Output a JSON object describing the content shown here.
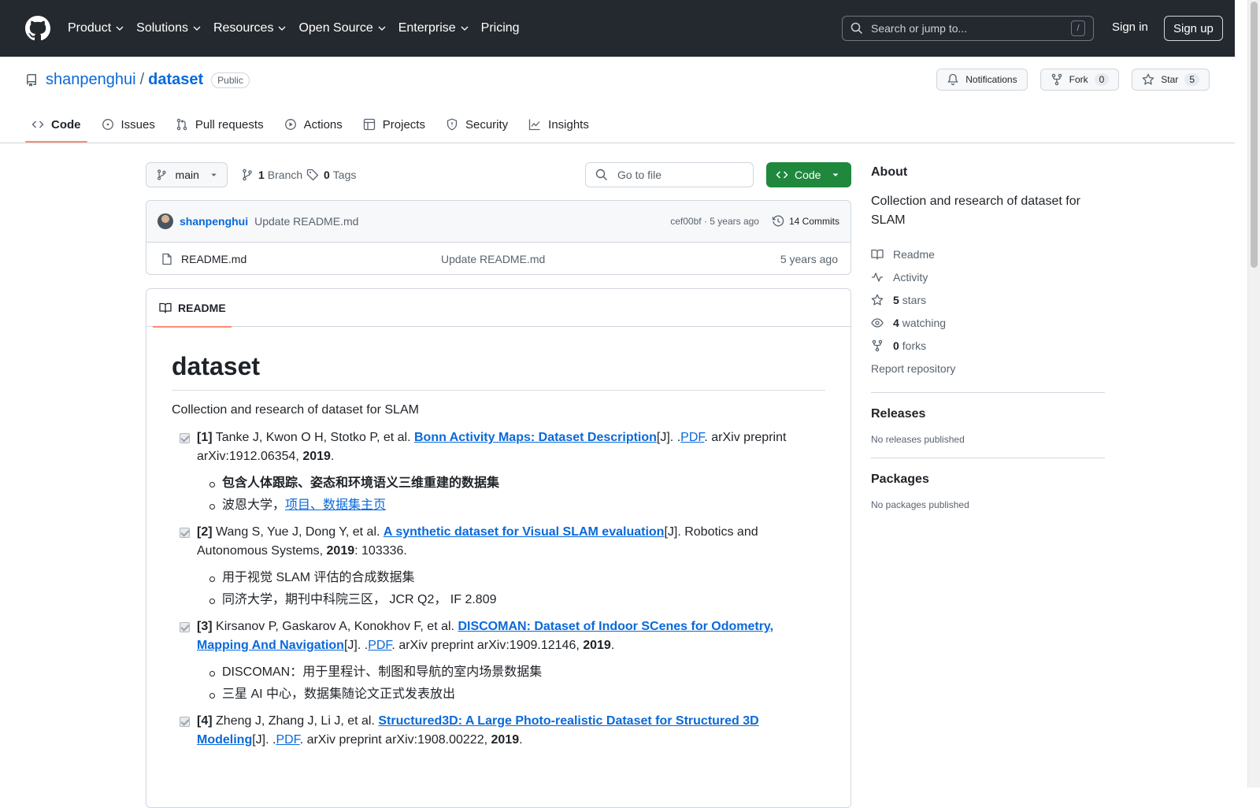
{
  "header": {
    "nav": [
      {
        "label": "Product",
        "dropdown": true
      },
      {
        "label": "Solutions",
        "dropdown": true
      },
      {
        "label": "Resources",
        "dropdown": true
      },
      {
        "label": "Open Source",
        "dropdown": true
      },
      {
        "label": "Enterprise",
        "dropdown": true
      },
      {
        "label": "Pricing",
        "dropdown": false
      }
    ],
    "search_placeholder": "Search or jump to...",
    "search_key": "/",
    "sign_in": "Sign in",
    "sign_up": "Sign up"
  },
  "repo": {
    "owner": "shanpenghui",
    "separator": "/",
    "name": "dataset",
    "visibility": "Public",
    "notifications": "Notifications",
    "fork_label": "Fork",
    "fork_count": "0",
    "star_label": "Star",
    "star_count": "5",
    "tabs": [
      "Code",
      "Issues",
      "Pull requests",
      "Actions",
      "Projects",
      "Security",
      "Insights"
    ]
  },
  "toolbar": {
    "branch": "main",
    "branch_count": "1",
    "branch_label": "Branch",
    "tag_count": "0",
    "tag_label": "Tags",
    "goto_placeholder": "Go to file",
    "code_button": "Code"
  },
  "commit": {
    "author": "shanpenghui",
    "message": "Update README.md",
    "hash_time": "cef00bf · 5 years ago",
    "count": "14 Commits"
  },
  "files": [
    {
      "name": "README.md",
      "message": "Update README.md",
      "time": "5 years ago"
    }
  ],
  "readme": {
    "tab": "README",
    "title": "dataset",
    "intro": "Collection and research of dataset for SLAM",
    "refs": [
      {
        "num": "[1]",
        "authors": "Tanke J, Kwon O H, Stotko P, et al.",
        "link": "Bonn Activity Maps: Dataset Description",
        "mid": "[J]. .",
        "pdf": "PDF",
        "tail": ". arXiv preprint arXiv:1912.06354,",
        "year": "2019",
        "end": ".",
        "subs": [
          "包含人体跟踪、姿态和环境语义三维重建的数据集",
          "波恩大学，"
        ],
        "sub_link": "项目、数据集主页"
      },
      {
        "num": "[2]",
        "authors": "Wang S, Yue J, Dong Y, et al.",
        "link": "A synthetic dataset for Visual SLAM evaluation",
        "tail": "[J]. Robotics and Autonomous Systems,",
        "year": "2019",
        "end": ": 103336.",
        "subs": [
          "用于视觉 SLAM 评估的合成数据集",
          "同济大学，期刊中科院三区， JCR Q2， IF 2.809"
        ]
      },
      {
        "num": "[3]",
        "authors": "Kirsanov P, Gaskarov A, Konokhov F, et al.",
        "link": "DISCOMAN: Dataset of Indoor SCenes for Odometry, Mapping And Navigation",
        "mid": "[J]. .",
        "pdf": "PDF",
        "tail": ". arXiv preprint arXiv:1909.12146,",
        "year": "2019",
        "end": ".",
        "subs": [
          "DISCOMAN：用于里程计、制图和导航的室内场景数据集",
          "三星 AI 中心，数据集随论文正式发表放出"
        ]
      },
      {
        "num": "[4]",
        "authors": "Zheng J, Zhang J, Li J, et al.",
        "link": "Structured3D: A Large Photo-realistic Dataset for Structured 3D Modeling",
        "mid": "[J]. .",
        "pdf": "PDF",
        "tail": ". arXiv preprint arXiv:1908.00222,",
        "year": "2019",
        "end": "."
      }
    ]
  },
  "sidebar": {
    "about_title": "About",
    "description": "Collection and research of dataset for SLAM",
    "readme": "Readme",
    "activity": "Activity",
    "stars_count": "5",
    "stars_label": "stars",
    "watching_count": "4",
    "watching_label": "watching",
    "forks_count": "0",
    "forks_label": "forks",
    "report": "Report repository",
    "releases_title": "Releases",
    "releases_empty": "No releases published",
    "packages_title": "Packages",
    "packages_empty": "No packages published"
  },
  "colors": {
    "header_bg": "#24292f",
    "link": "#0969da",
    "primary_button": "#1f883d",
    "active_tab_underline": "#fd8c73"
  }
}
